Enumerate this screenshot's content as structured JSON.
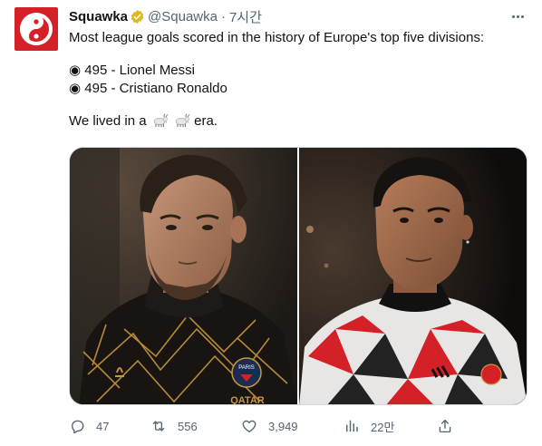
{
  "author": {
    "name": "Squawka",
    "handle": "@Squawka",
    "separator": "·",
    "time": "7시간"
  },
  "tweet": {
    "line1": "Most league goals scored in the history of Europe's top five divisions:",
    "line2": "◉ 495 - Lionel Messi",
    "line3": "◉ 495 - Cristiano Ronaldo",
    "line4_prefix": "We lived in a",
    "line4_suffix": "era."
  },
  "media": {
    "left_jersey_text": "QATAR",
    "left_badge_text": "PARIS"
  },
  "actions": {
    "replies": "47",
    "retweets": "556",
    "likes": "3,949",
    "views": "22만"
  },
  "icons": {
    "avatar": "squawka-logo-icon",
    "verified": "verified-badge-icon",
    "more": "more-icon",
    "reply": "reply-icon",
    "retweet": "retweet-icon",
    "like": "heart-icon",
    "views": "views-icon",
    "share": "share-icon",
    "goat": "goat-emoji-icon"
  },
  "colors": {
    "brand": "#d42027",
    "verified_gold": "#e2b719",
    "muted_text": "#536471"
  }
}
